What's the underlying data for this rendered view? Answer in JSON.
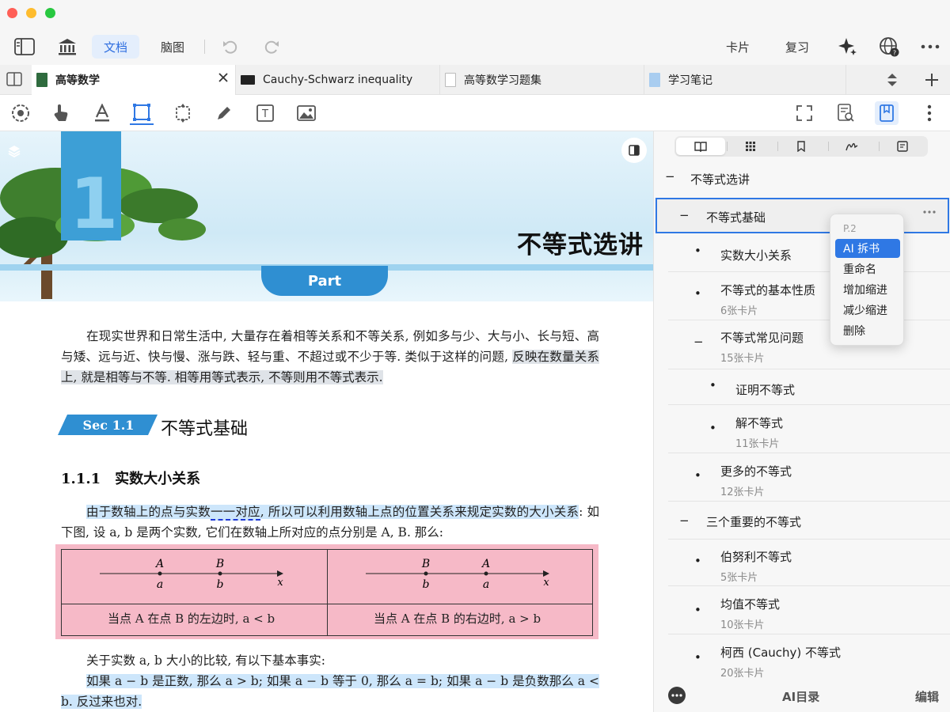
{
  "window": {
    "traffic_colors": [
      "#ff5f57",
      "#febc2e",
      "#28c840"
    ]
  },
  "toolbar": {
    "doc_label": "文档",
    "mindmap_label": "脑图",
    "cards_label": "卡片",
    "review_label": "复习"
  },
  "tabs": [
    {
      "label": "高等数学",
      "active": true
    },
    {
      "label": "Cauchy-Schwarz inequality"
    },
    {
      "label": "高等数学习题集"
    },
    {
      "label": "学习笔记"
    }
  ],
  "doc": {
    "part_title": "不等式选讲",
    "part_label": "Part",
    "chapter_number": "1",
    "intro_plain": "在现实世界和日常生活中, 大量存在着相等关系和不等关系, 例如多与少、大与小、长与短、高与矮、远与近、快与慢、涨与跌、轻与重、不超过或不少于等. 类似于这样的问题,",
    "intro_hl": "反映在数量关系上, 就是相等与不等. 相等用等式表示, 不等则用不等式表示.",
    "sec_badge": "Sec 1.1",
    "sec_title": "不等式基础",
    "sub_title": "1.1.1　实数大小关系",
    "p2_hl_a": "由于数轴上的点与实数",
    "p2_underline": "一一对应",
    "p2_hl_b": ", 所以可以利用数轴上点的位置关系来规定实数的大小关系",
    "p2_rest": ": 如下图, 设 a, b 是两个实数, 它们在数轴上所对应的点分别是 A, B. 那么:",
    "fig_left": {
      "top_a": "A",
      "top_b": "B",
      "bot_a": "a",
      "bot_b": "b",
      "axis": "x",
      "caption": "当点 A 在点 B 的左边时, a < b"
    },
    "fig_right": {
      "top_b": "B",
      "top_a": "A",
      "bot_b": "b",
      "bot_a": "a",
      "axis": "x",
      "caption": "当点 A 在点 B 的右边时, a > b"
    },
    "p3": "关于实数 a, b 大小的比较, 有以下基本事实:",
    "p4_hl": "如果 a − b 是正数, 那么 a > b; 如果 a − b 等于 0, 那么 a = b; 如果 a − b 是负数那么 a < b. 反过来也对."
  },
  "panel": {
    "toc": [
      {
        "title": "不等式选讲",
        "marker": "−"
      },
      {
        "title": "不等式基础",
        "marker": "−",
        "selected": true
      },
      {
        "title": "实数大小关系",
        "marker": "•"
      },
      {
        "title": "不等式的基本性质",
        "sub": "6张卡片",
        "marker": "•"
      },
      {
        "title": "不等式常见问题",
        "sub": "15张卡片",
        "marker": "−"
      },
      {
        "title": "证明不等式",
        "marker": "•"
      },
      {
        "title": "解不等式",
        "sub": "11张卡片",
        "marker": "•"
      },
      {
        "title": "更多的不等式",
        "sub": "12张卡片",
        "marker": "•"
      },
      {
        "title": "三个重要的不等式",
        "marker": "−"
      },
      {
        "title": "伯努利不等式",
        "sub": "5张卡片",
        "marker": "•"
      },
      {
        "title": "均值不等式",
        "sub": "10张卡片",
        "marker": "•"
      },
      {
        "title": "柯西 (Cauchy) 不等式",
        "sub": "20张卡片",
        "marker": "•"
      }
    ],
    "context_menu": {
      "page": "P.2",
      "items": [
        "AI 拆书",
        "重命名",
        "增加缩进",
        "减少缩进",
        "删除"
      ]
    },
    "footer": {
      "ai_toc": "AI目录",
      "edit": "编辑"
    }
  },
  "colors": {
    "accent": "#2f78e4",
    "chapter_blue": "#3d9fd6",
    "figure_pink": "#f6b9c7",
    "highlight_blue": "#cde6fb",
    "highlight_gray": "#dfe3e8"
  }
}
